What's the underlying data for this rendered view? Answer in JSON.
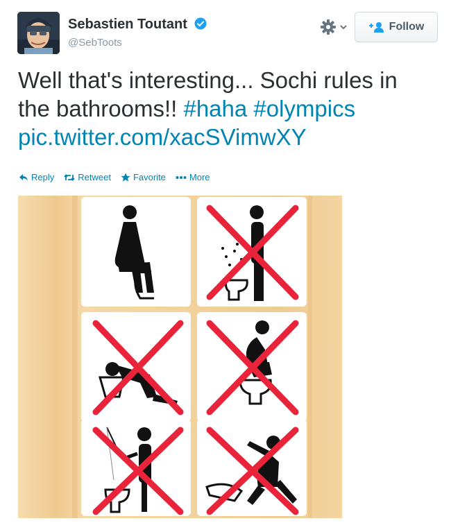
{
  "author": {
    "name": "Sebastien Toutant",
    "handle": "@SebToots",
    "verified": true
  },
  "follow_button": {
    "label": "Follow"
  },
  "settings": {
    "icon": "gear-icon"
  },
  "tweet": {
    "text_plain": "Well that's interesting... Sochi rules in the bathrooms!!",
    "hashtags": [
      "#haha",
      "#olympics"
    ],
    "link": "pic.twitter.com/xacSVimwXY"
  },
  "actions": [
    {
      "label": "Reply",
      "icon": "reply-icon"
    },
    {
      "label": "Retweet",
      "icon": "retweet-icon"
    },
    {
      "label": "Favorite",
      "icon": "star-icon"
    },
    {
      "label": "More",
      "icon": "more-dots-icon"
    }
  ],
  "colors": {
    "link": "#0084b4",
    "text": "#292f33",
    "muted": "#8899a6",
    "verified": "#1da1f2",
    "cross": "#e8233a",
    "wall": "#f2d29f"
  }
}
